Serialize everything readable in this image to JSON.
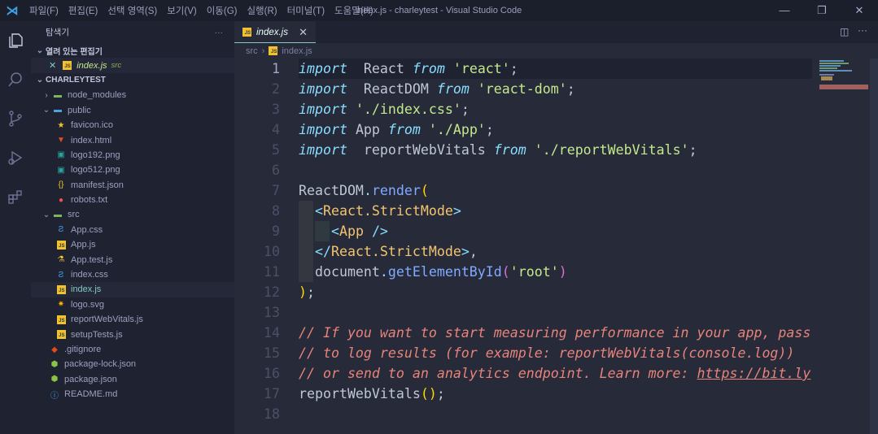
{
  "titlebar": {
    "menus": [
      "파일(F)",
      "편집(E)",
      "선택 영역(S)",
      "보기(V)",
      "이동(G)",
      "실행(R)",
      "터미널(T)",
      "도움말(H)"
    ],
    "title": "index.js - charleytest - Visual Studio Code"
  },
  "sidebar": {
    "title": "탐색기",
    "more": "···",
    "open_editors": "열려 있는 편집기",
    "open_file": {
      "name": "index.js",
      "dir": "src"
    },
    "project": "CHARLEYTEST",
    "tree": [
      {
        "name": "node_modules",
        "icon": "folder-icon",
        "color": "#7fb65a",
        "depth": 0,
        "chev": "›"
      },
      {
        "name": "public",
        "icon": "folder-icon",
        "color": "#4aa3e0",
        "depth": 0,
        "chev": "⌄"
      },
      {
        "name": "favicon.ico",
        "icon": "star-icon",
        "color": "#f2c12e",
        "depth": 1
      },
      {
        "name": "index.html",
        "icon": "html-icon",
        "color": "#e44d26",
        "depth": 1
      },
      {
        "name": "logo192.png",
        "icon": "image-icon",
        "color": "#26a69a",
        "depth": 1
      },
      {
        "name": "logo512.png",
        "icon": "image-icon",
        "color": "#26a69a",
        "depth": 1
      },
      {
        "name": "manifest.json",
        "icon": "json-icon",
        "color": "#f2c12e",
        "depth": 1
      },
      {
        "name": "robots.txt",
        "icon": "robot-icon",
        "color": "#ef5350",
        "depth": 1
      },
      {
        "name": "src",
        "icon": "folder-icon",
        "color": "#7fb65a",
        "depth": 0,
        "chev": "⌄"
      },
      {
        "name": "App.css",
        "icon": "css-icon",
        "color": "#42a5f5",
        "depth": 1
      },
      {
        "name": "App.js",
        "icon": "js-icon",
        "color": "#f2c12e",
        "depth": 1
      },
      {
        "name": "App.test.js",
        "icon": "flask-icon",
        "color": "#f2c12e",
        "depth": 1
      },
      {
        "name": "index.css",
        "icon": "css-icon",
        "color": "#42a5f5",
        "depth": 1
      },
      {
        "name": "index.js",
        "icon": "js-icon",
        "color": "#f2c12e",
        "depth": 1,
        "selected": true
      },
      {
        "name": "logo.svg",
        "icon": "svg-icon",
        "color": "#ffb300",
        "depth": 1
      },
      {
        "name": "reportWebVitals.js",
        "icon": "js-icon",
        "color": "#f2c12e",
        "depth": 1
      },
      {
        "name": "setupTests.js",
        "icon": "js-icon",
        "color": "#f2c12e",
        "depth": 1
      },
      {
        "name": ".gitignore",
        "icon": "git-icon",
        "color": "#e64a19",
        "depth": 0
      },
      {
        "name": "package-lock.json",
        "icon": "node-icon",
        "color": "#8bc34a",
        "depth": 0
      },
      {
        "name": "package.json",
        "icon": "node-icon",
        "color": "#8bc34a",
        "depth": 0
      },
      {
        "name": "README.md",
        "icon": "info-icon",
        "color": "#42a5f5",
        "depth": 0
      }
    ]
  },
  "tab": {
    "label": "index.js",
    "close": "✕"
  },
  "breadcrumb": {
    "folder": "src",
    "file": "index.js"
  },
  "editor": {
    "current_line": 1,
    "lines": [
      [
        [
          "kw",
          "import"
        ],
        [
          "",
          "  React "
        ],
        [
          "kw",
          "from"
        ],
        [
          "str",
          " 'react'"
        ],
        [
          "",
          "; "
        ]
      ],
      [
        [
          "kw",
          "import"
        ],
        [
          "",
          "  ReactDOM "
        ],
        [
          "kw",
          "from"
        ],
        [
          "str",
          " 'react-dom'"
        ],
        [
          "",
          ";"
        ]
      ],
      [
        [
          "kw",
          "import"
        ],
        [
          "str",
          " './index.css'"
        ],
        [
          "",
          ";"
        ]
      ],
      [
        [
          "kw",
          "import"
        ],
        [
          "",
          "",
          " App "
        ],
        [
          "kw",
          "from"
        ],
        [
          "str",
          " './App'"
        ],
        [
          "",
          ";"
        ]
      ],
      [
        [
          "kw",
          "import"
        ],
        [
          "",
          "  reportWebVitals "
        ],
        [
          "kw",
          "from"
        ],
        [
          "str",
          " './reportWebVitals'"
        ],
        [
          "",
          ";"
        ]
      ],
      [],
      [
        [
          "",
          "ReactDOM"
        ],
        [
          "pu",
          "."
        ],
        [
          "fn",
          "render"
        ],
        [
          "br",
          "("
        ]
      ],
      [
        [
          "",
          "  "
        ],
        [
          "pu",
          "<"
        ],
        [
          "tg",
          "React.StrictMode"
        ],
        [
          "pu",
          ">"
        ]
      ],
      [
        [
          "",
          "    "
        ],
        [
          "pu",
          "<"
        ],
        [
          "tg",
          "App"
        ],
        [
          "pu",
          " />"
        ]
      ],
      [
        [
          "",
          "  "
        ],
        [
          "pu",
          "</"
        ],
        [
          "tg",
          "React.StrictMode"
        ],
        [
          "pu",
          ">"
        ],
        [
          "",
          ","
        ]
      ],
      [
        [
          "",
          "  document"
        ],
        [
          "pu",
          "."
        ],
        [
          "fn",
          "getElementById"
        ],
        [
          "br2",
          "("
        ],
        [
          "str",
          "'root'"
        ],
        [
          "br2",
          ")"
        ]
      ],
      [
        [
          "br",
          ")"
        ],
        [
          "",
          ";"
        ]
      ],
      [],
      [
        [
          "cm",
          "// If you want to start measuring performance in your app, pass"
        ]
      ],
      [
        [
          "cm",
          "// to log results (for example: reportWebVitals(console.log))"
        ]
      ],
      [
        [
          "cm",
          "// or send to an analytics endpoint. Learn more: "
        ],
        [
          "cm ul",
          "https://bit.ly"
        ]
      ],
      [
        [
          "",
          "reportWebVitals"
        ],
        [
          "br",
          "("
        ],
        [
          "br",
          ")"
        ],
        [
          "",
          ";"
        ]
      ],
      []
    ]
  }
}
